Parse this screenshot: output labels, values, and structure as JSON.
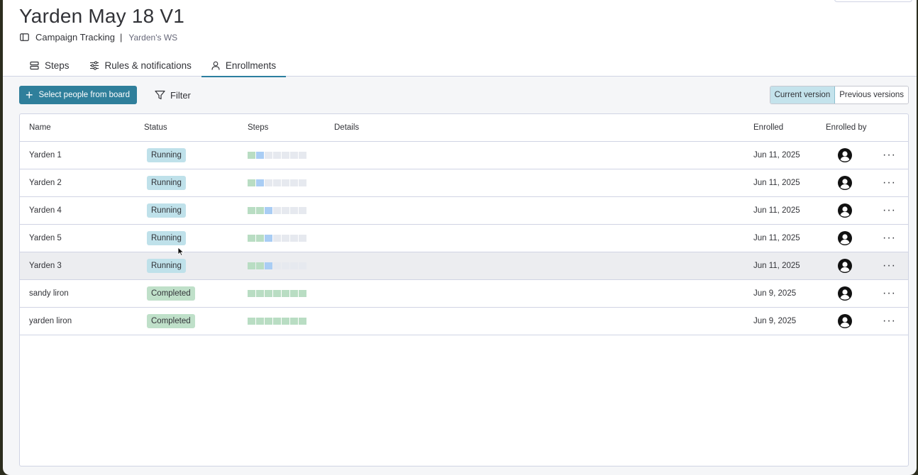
{
  "header": {
    "title": "Yarden May 18 V1",
    "board_name": "Campaign Tracking",
    "separator": "|",
    "workspace": "Yarden's WS"
  },
  "tabs": [
    {
      "label": "Steps",
      "icon": "steps-icon",
      "active": false
    },
    {
      "label": "Rules & notifications",
      "icon": "sliders-icon",
      "active": false
    },
    {
      "label": "Enrollments",
      "icon": "person-icon",
      "active": true
    }
  ],
  "toolbar": {
    "primary_label": "Select people from board",
    "filter_label": "Filter",
    "current_version": "Current version",
    "previous_versions": "Previous versions"
  },
  "table": {
    "columns": [
      "Name",
      "Status",
      "Steps",
      "Details",
      "Enrolled",
      "Enrolled by"
    ],
    "rows": [
      {
        "name": "Yarden 1",
        "status": "Running",
        "steps": [
          "done",
          "current",
          "todo",
          "todo",
          "todo",
          "todo",
          "todo"
        ],
        "enrolled": "Jun 11, 2025"
      },
      {
        "name": "Yarden 2",
        "status": "Running",
        "steps": [
          "done",
          "current",
          "todo",
          "todo",
          "todo",
          "todo",
          "todo"
        ],
        "enrolled": "Jun 11, 2025"
      },
      {
        "name": "Yarden 4",
        "status": "Running",
        "steps": [
          "done",
          "done",
          "current",
          "todo",
          "todo",
          "todo",
          "todo"
        ],
        "enrolled": "Jun 11, 2025"
      },
      {
        "name": "Yarden 5",
        "status": "Running",
        "steps": [
          "done",
          "done",
          "current",
          "todo",
          "todo",
          "todo",
          "todo"
        ],
        "enrolled": "Jun 11, 2025"
      },
      {
        "name": "Yarden 3",
        "status": "Running",
        "steps": [
          "done",
          "done",
          "current",
          "todo",
          "todo",
          "todo",
          "todo"
        ],
        "enrolled": "Jun 11, 2025"
      },
      {
        "name": "sandy liron",
        "status": "Completed",
        "steps": [
          "done",
          "done",
          "done",
          "done",
          "done",
          "done",
          "done"
        ],
        "enrolled": "Jun 9, 2025"
      },
      {
        "name": "yarden liron",
        "status": "Completed",
        "steps": [
          "done",
          "done",
          "done",
          "done",
          "done",
          "done",
          "done"
        ],
        "enrolled": "Jun 9, 2025"
      }
    ],
    "highlighted_row": 4,
    "more_label": "···"
  },
  "colors": {
    "primary": "#2f7f9b",
    "running_badge": "#bfe1ea",
    "completed_badge": "#bfe0c9",
    "step_done": "#b9ddc3",
    "step_current": "#a9cdf4",
    "step_todo": "#e6e9ef"
  }
}
